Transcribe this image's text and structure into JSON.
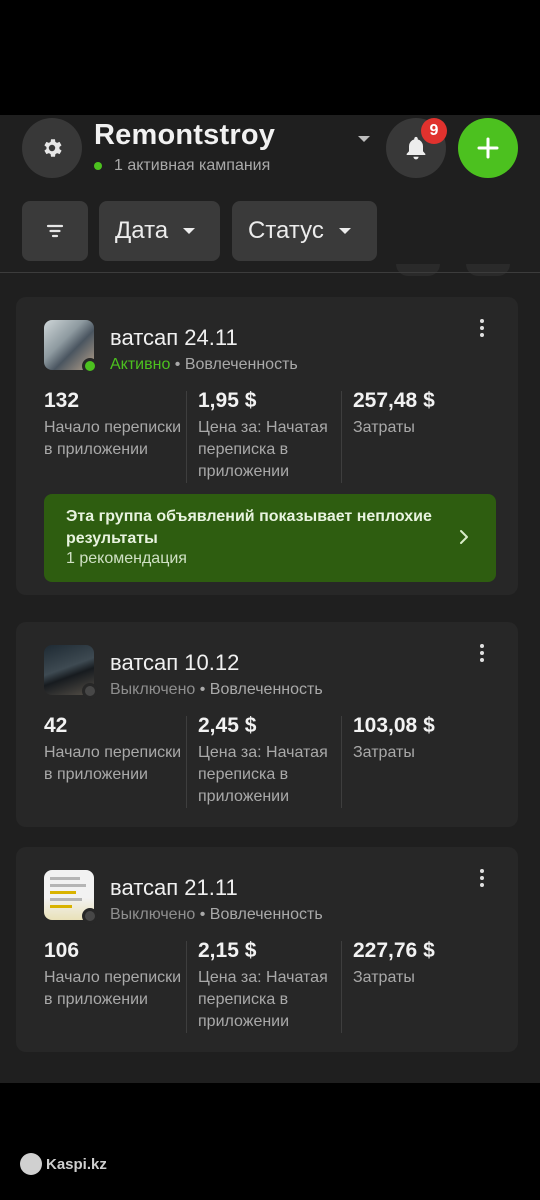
{
  "header": {
    "account_name": "Remontstroy",
    "account_status": "1 активная кампания",
    "notifications_count": "9"
  },
  "filters": {
    "date_label": "Дата",
    "status_label": "Статус"
  },
  "colors": {
    "active_green": "#4cc11f",
    "badge_red": "#e0322e",
    "recommendation_bg": "#2e5d10"
  },
  "ads": [
    {
      "title": "ватсап 24.11",
      "status": "Активно",
      "status_active": true,
      "sub": " • Вовлеченность",
      "metric1_value": "132",
      "metric1_label": "Начало переписки в приложении",
      "metric2_value": "1,95 $",
      "metric2_label": "Цена за: Начатая переписка в приложении",
      "metric3_value": "257,48 $",
      "metric3_label": "Затраты",
      "recommendation": {
        "title": "Эта группа объявлений показывает неплохие результаты",
        "subtitle": "1 рекомендация"
      }
    },
    {
      "title": "ватсап 10.12",
      "status": "Выключено",
      "status_active": false,
      "sub": " • Вовлеченность",
      "metric1_value": "42",
      "metric1_label": "Начало переписки в приложении",
      "metric2_value": "2,45 $",
      "metric2_label": "Цена за: Начатая переписка в приложении",
      "metric3_value": "103,08 $",
      "metric3_label": "Затраты"
    },
    {
      "title": "ватсап 21.11",
      "status": "Выключено",
      "status_active": false,
      "sub": " • Вовлеченность",
      "metric1_value": "106",
      "metric1_label": "Начало переписки в приложении",
      "metric2_value": "2,15 $",
      "metric2_label": "Цена за: Начатая переписка в приложении",
      "metric3_value": "227,76 $",
      "metric3_label": "Затраты"
    }
  ],
  "watermark": "Kaspi.kz"
}
